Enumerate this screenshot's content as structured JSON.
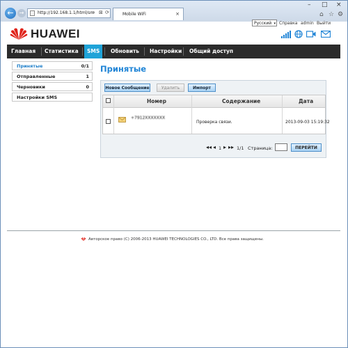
{
  "browser": {
    "url": "http://192.168.1.1/html/sm",
    "tab_title": "Mobile WiFi",
    "tab_close": "×",
    "minimize": "–",
    "maximize": "□",
    "close": "×",
    "search_glyph": "⌕",
    "stop_glyph": "⊠",
    "reload_glyph": "⟳",
    "home_glyph": "⌂",
    "star_glyph": "☆",
    "settings_glyph": "⚙",
    "back_glyph": "←",
    "forward_glyph": "→"
  },
  "header": {
    "logo_text": "HUAWEI",
    "language": "Русский",
    "language_arrow": "▾",
    "help_link": "Справка",
    "user_link": "admin",
    "logout_link": "Выйти",
    "status_icons": [
      "signal-icon",
      "wifi-icon",
      "globe-icon",
      "mobile-network-icon",
      "envelope-icon"
    ]
  },
  "nav": {
    "items": [
      "Главная",
      "Статистика",
      "SMS",
      "Обновить",
      "Настройки",
      "Общий доступ"
    ],
    "active": "SMS"
  },
  "sidebar": {
    "items": [
      {
        "label": "Принятые",
        "count": "0/1"
      },
      {
        "label": "Отправленные",
        "count": "1"
      },
      {
        "label": "Черновики",
        "count": "0"
      },
      {
        "label": "Настройки SMS",
        "count": ""
      }
    ]
  },
  "main": {
    "title": "Принятые",
    "buttons": {
      "new": "Новое Сообщение",
      "delete": "Удалить",
      "import": "Импорт"
    },
    "columns": [
      "Номер",
      "Содержание",
      "Дата"
    ],
    "rows": [
      {
        "number": "+7912XXXXXXX",
        "content": "Проверка связи.",
        "date": "2013-09-03 15:19:32"
      }
    ]
  },
  "pagination": {
    "first": "◂◂",
    "prev": "◂",
    "current": "1",
    "next": "▸",
    "last": "▸▸",
    "total": "1/1",
    "page_label": "Страница:",
    "go_button": "ПЕРЕЙТИ"
  },
  "footer": {
    "copyright": "Авторское право (C) 2006-2013 HUAWEI TECHNOLOGIES CO., LTD. Все права защищены."
  },
  "colors": {
    "accent": "#1fa3d8",
    "nav_bg": "#2b2b2b",
    "title": "#1f84d6",
    "brand_red": "#e0231a"
  }
}
